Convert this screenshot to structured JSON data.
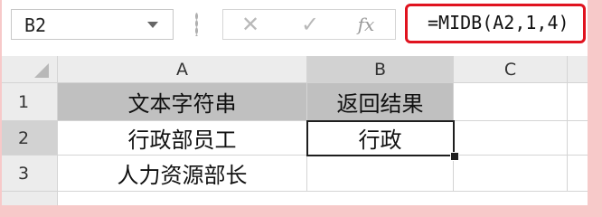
{
  "formula_bar": {
    "name_box": "B2",
    "cancel_glyph": "✕",
    "enter_glyph": "✓",
    "fx_label": "fx",
    "formula": "=MIDB(A2,1,4)"
  },
  "sheet": {
    "columns": [
      "A",
      "B",
      "C"
    ],
    "rows": [
      {
        "num": "1",
        "cells": [
          "文本字符串",
          "返回结果",
          ""
        ]
      },
      {
        "num": "2",
        "cells": [
          "行政部员工",
          "行政",
          ""
        ]
      },
      {
        "num": "3",
        "cells": [
          "人力资源部长",
          "",
          ""
        ]
      }
    ],
    "active_cell": "B2"
  },
  "colors": {
    "formula_highlight": "#e0131f",
    "header_fill": "#c0c0c0",
    "background": "#f7c9c9"
  }
}
